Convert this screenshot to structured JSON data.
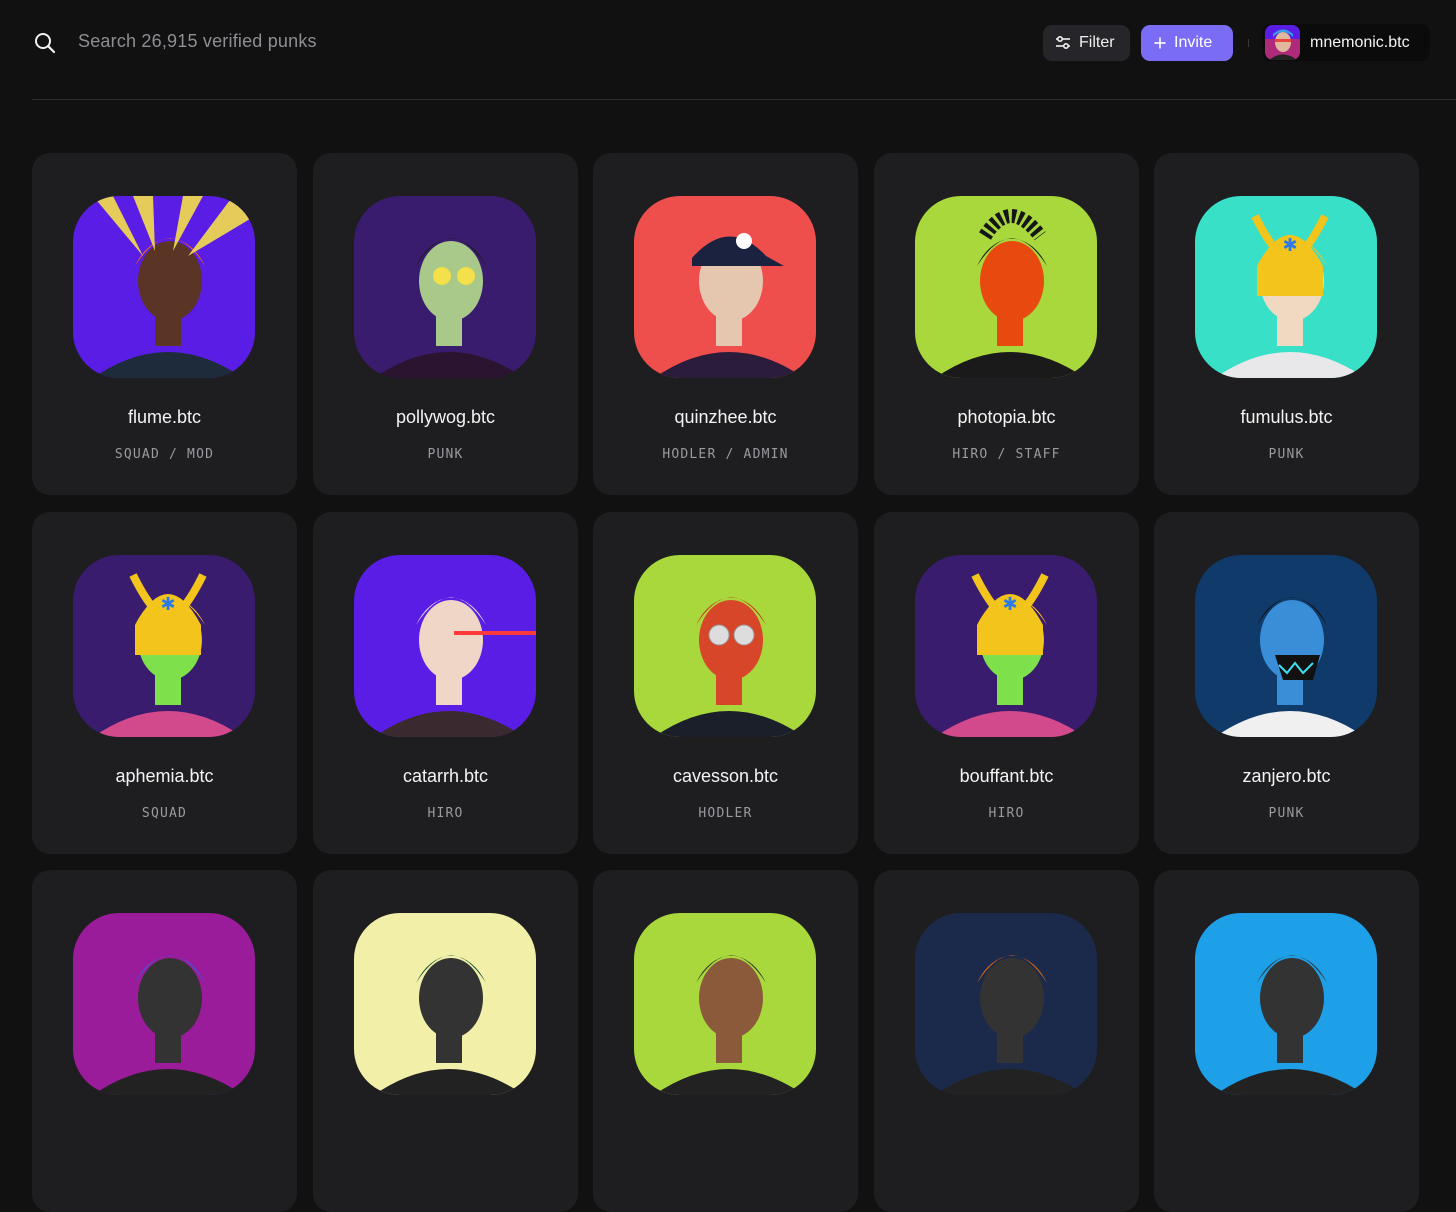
{
  "search": {
    "placeholder": "Search 26,915 verified punks",
    "icon": "search-icon"
  },
  "toolbar": {
    "filter_label": "Filter",
    "invite_label": "Invite"
  },
  "user": {
    "name": "mnemonic.btc"
  },
  "colors": {
    "accent": "#7b6cf6",
    "background": "#111112",
    "card": "#1e1e20"
  },
  "cards": [
    {
      "name": "flume.btc",
      "role": "SQUAD  /  MOD",
      "bg": "#5a1de6",
      "skin": "#5a3424",
      "hair": "#f06a0c",
      "outfit": "#1d2b3a",
      "accessory": "halo"
    },
    {
      "name": "pollywog.btc",
      "role": "PUNK",
      "bg": "#3a1c6e",
      "skin": "#a8c98a",
      "hair": "#1e1e1e",
      "outfit": "#2a1430",
      "accessory": "goggles"
    },
    {
      "name": "quinzhee.btc",
      "role": "HODLER  /  ADMIN",
      "bg": "#ee4f4c",
      "skin": "#e5c7b0",
      "hair": "#1b2240",
      "outfit": "#2a1c3a",
      "accessory": "cap"
    },
    {
      "name": "photopia.btc",
      "role": "HIRO  /  STAFF",
      "bg": "#a8d83c",
      "skin": "#e8490f",
      "hair": "#161616",
      "outfit": "#1a1a1a",
      "accessory": "dreads"
    },
    {
      "name": "fumulus.btc",
      "role": "PUNK",
      "bg": "#38e0c8",
      "skin": "#f0d9c0",
      "hair": "#f2c41c",
      "outfit": "#e8e8ea",
      "accessory": "helmet"
    },
    {
      "name": "aphemia.btc",
      "role": "SQUAD",
      "bg": "#3a1c6e",
      "skin": "#7ee04a",
      "hair": "#f2c41c",
      "outfit": "#d24a8c",
      "accessory": "helmet"
    },
    {
      "name": "catarrh.btc",
      "role": "HIRO",
      "bg": "#5a1de6",
      "skin": "#f0d6c6",
      "hair": "#d8d8de",
      "outfit": "#3a2a30",
      "accessory": "laser"
    },
    {
      "name": "cavesson.btc",
      "role": "HODLER",
      "bg": "#a8d83c",
      "skin": "#d8462a",
      "hair": "#c9361c",
      "outfit": "#1b1f2a",
      "accessory": "glasses"
    },
    {
      "name": "bouffant.btc",
      "role": "HIRO",
      "bg": "#3a1c6e",
      "skin": "#7ee04a",
      "hair": "#f2c41c",
      "outfit": "#d24a8c",
      "accessory": "helmet"
    },
    {
      "name": "zanjero.btc",
      "role": "PUNK",
      "bg": "#0f3a6a",
      "skin": "#3a8ed8",
      "hair": "#121212",
      "outfit": "#f0f0f0",
      "accessory": "mask"
    },
    {
      "name": "",
      "role": "",
      "bg": "#9a1c9a",
      "skin": "#333",
      "hair": "#3a5ad8",
      "outfit": "#222",
      "accessory": "none"
    },
    {
      "name": "",
      "role": "",
      "bg": "#f2f0a8",
      "skin": "#333",
      "hair": "#1e5a3a",
      "outfit": "#222",
      "accessory": "none"
    },
    {
      "name": "",
      "role": "",
      "bg": "#a8d83c",
      "skin": "#8a5a3a",
      "hair": "#333",
      "outfit": "#222",
      "accessory": "none"
    },
    {
      "name": "",
      "role": "",
      "bg": "#1b2a4a",
      "skin": "#333",
      "hair": "#f06a0c",
      "outfit": "#222",
      "accessory": "none"
    },
    {
      "name": "",
      "role": "",
      "bg": "#1ea0e8",
      "skin": "#333",
      "hair": "#333",
      "outfit": "#222",
      "accessory": "none"
    }
  ]
}
